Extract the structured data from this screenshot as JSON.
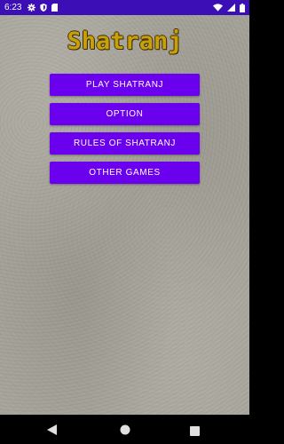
{
  "status_bar": {
    "time": "6:23",
    "left_icons": [
      "gear-icon",
      "shield-icon",
      "sd-card-icon"
    ],
    "right_icons": [
      "wifi-icon",
      "signal-icon",
      "battery-icon"
    ],
    "background": "#3b0fb5"
  },
  "app": {
    "title": "Shatranj",
    "title_color": "#c9a00a",
    "button_color": "#6a00ee"
  },
  "menu": {
    "play_label": "PLAY SHATRANJ",
    "option_label": "OPTION",
    "rules_label": "RULES OF SHATRANJ",
    "other_games_label": "OTHER GAMES"
  },
  "nav_bar": {
    "icons": [
      "back-icon",
      "home-icon",
      "recents-icon"
    ]
  }
}
